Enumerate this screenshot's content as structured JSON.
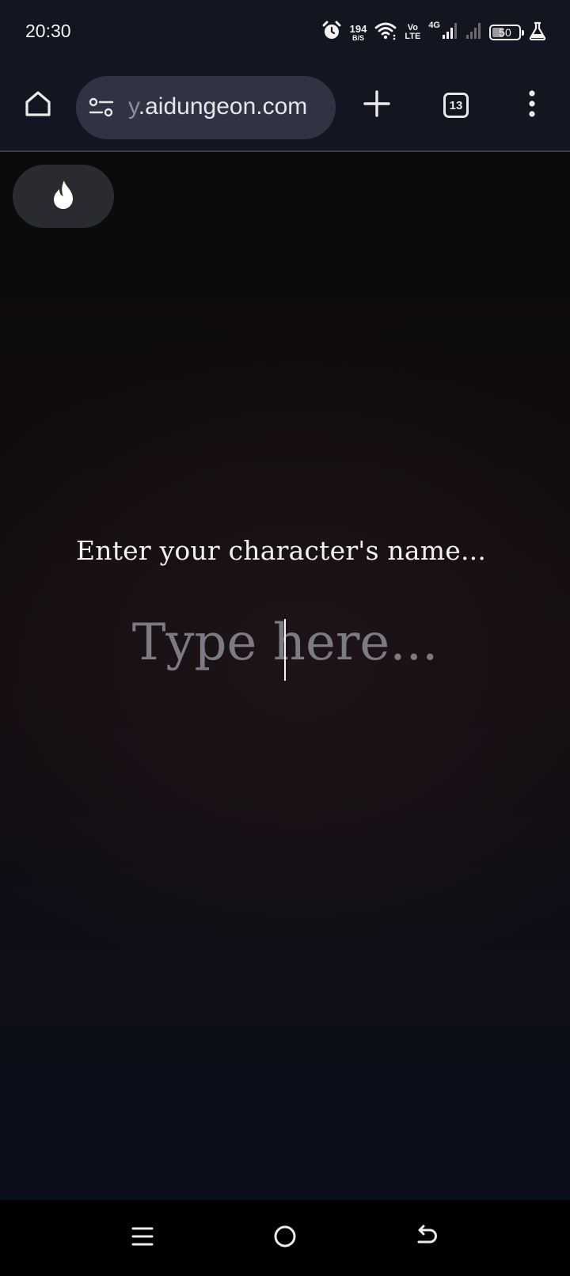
{
  "status_bar": {
    "time": "20:30",
    "net_speed_value": "194",
    "net_speed_unit": "B/S",
    "volte_top": "Vo",
    "volte_bottom": "LTE",
    "network_type": "4G",
    "battery_level": "50",
    "icons": [
      "alarm-icon",
      "wifi-icon",
      "signal-icon",
      "signal-weak-icon",
      "battery-icon",
      "beaker-icon"
    ]
  },
  "browser": {
    "url_prefix": "y",
    "url_domain": ".aidungeon.com",
    "tab_count": "13",
    "icons": [
      "home-icon",
      "site-settings-icon",
      "new-tab-icon",
      "tabs-icon",
      "menu-icon"
    ]
  },
  "page": {
    "prompt_label": "Enter your character's name...",
    "name_input": {
      "value": "",
      "placeholder": "Type here..."
    },
    "icons": [
      "flame-icon"
    ]
  },
  "nav_bar": {
    "icons": [
      "recents-icon",
      "home-circle-icon",
      "back-icon"
    ]
  },
  "colors": {
    "status_bg": "#131621",
    "url_pill_bg": "#2f3344",
    "flame_button_bg": "#2a2b30",
    "placeholder": "#7c7a82",
    "text": "#f1f1f3"
  }
}
